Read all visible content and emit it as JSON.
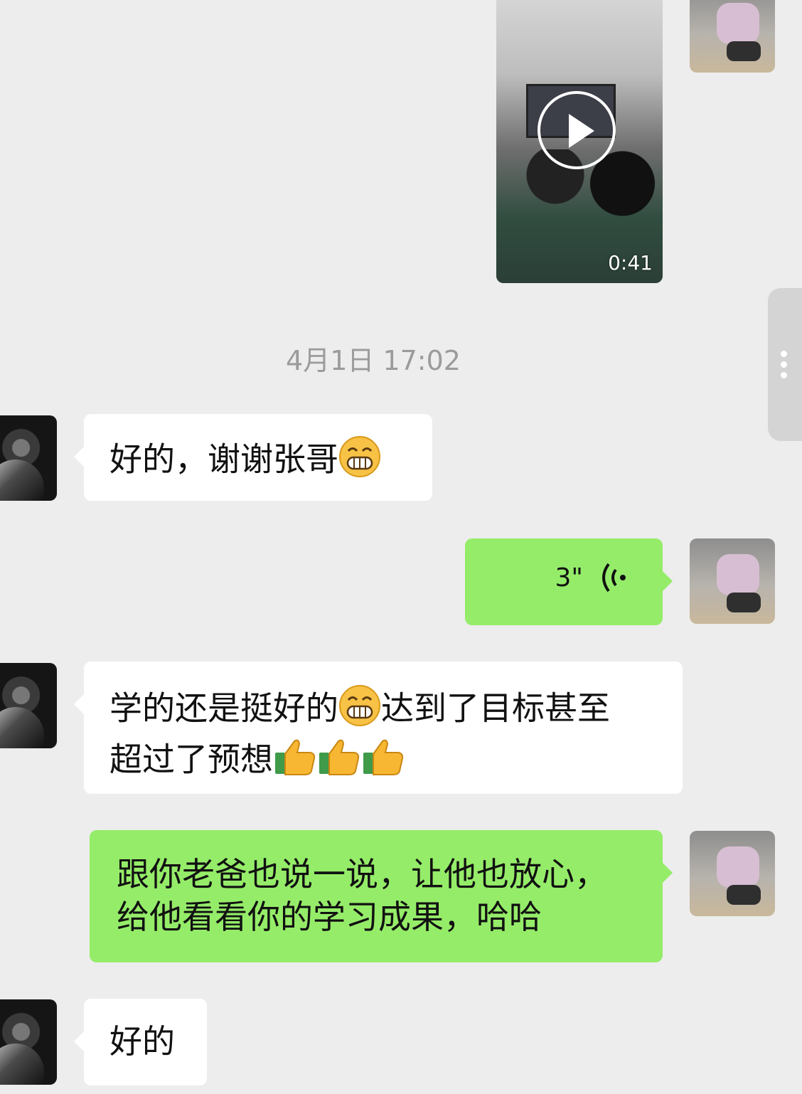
{
  "chat": {
    "video": {
      "duration": "0:41"
    },
    "timestamp": "4月1日 17:02",
    "messages": [
      {
        "from": "other",
        "type": "text",
        "text": "好的，谢谢张哥",
        "emoji": [
          "grinning"
        ]
      },
      {
        "from": "self",
        "type": "voice",
        "duration": "3\""
      },
      {
        "from": "other",
        "type": "text",
        "line1": "学的还是挺好的",
        "line1b": "达到了目标甚至",
        "line2": "超过了预想",
        "emoji": [
          "grinning",
          "thumbs-up",
          "thumbs-up",
          "thumbs-up"
        ]
      },
      {
        "from": "self",
        "type": "text",
        "line1": "跟你老爸也说一说，让他也放心，",
        "line2": "给他看看你的学习成果，哈哈"
      },
      {
        "from": "other",
        "type": "text",
        "text": "好的"
      }
    ]
  },
  "colors": {
    "background": "#ededed",
    "self_bubble": "#95ec69",
    "other_bubble": "#ffffff",
    "timestamp": "#9b9b9b"
  }
}
